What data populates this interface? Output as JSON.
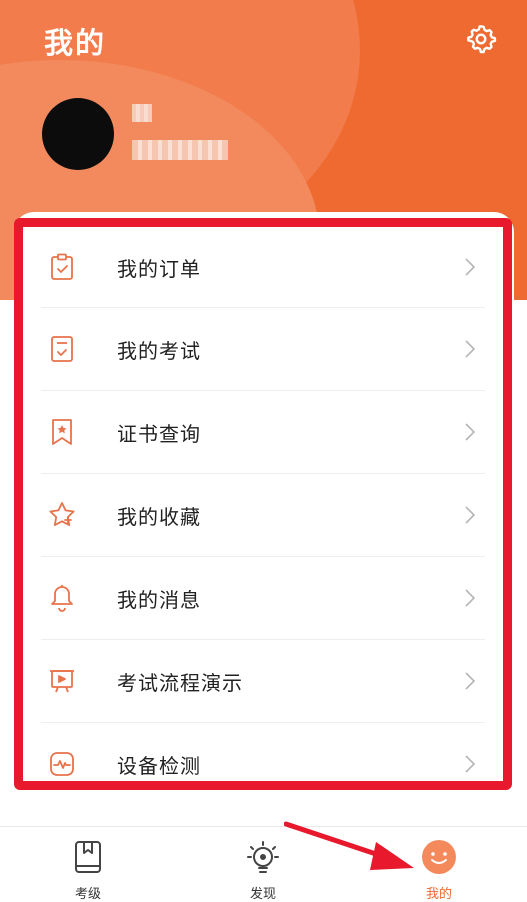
{
  "header": {
    "title": "我的",
    "username": "",
    "user_id": ""
  },
  "icons": {
    "settings": "gear-icon",
    "orders": "clipboard-check-icon",
    "exams": "document-check-icon",
    "certificate": "bookmark-star-icon",
    "favorites": "star-icon",
    "messages": "bell-icon",
    "demo": "play-screen-icon",
    "device": "heartbeat-icon",
    "chevron": "chevron-right-icon"
  },
  "menu": {
    "items": [
      {
        "label": "我的订单"
      },
      {
        "label": "我的考试"
      },
      {
        "label": "证书查询"
      },
      {
        "label": "我的收藏"
      },
      {
        "label": "我的消息"
      },
      {
        "label": "考试流程演示"
      },
      {
        "label": "设备检测"
      }
    ]
  },
  "tabbar": {
    "tabs": [
      {
        "label": "考级",
        "active": false
      },
      {
        "label": "发现",
        "active": false
      },
      {
        "label": "我的",
        "active": true
      }
    ]
  },
  "colors": {
    "accent": "#ee6a30",
    "highlight_border": "#e8192c",
    "icon": "#e8734a"
  }
}
